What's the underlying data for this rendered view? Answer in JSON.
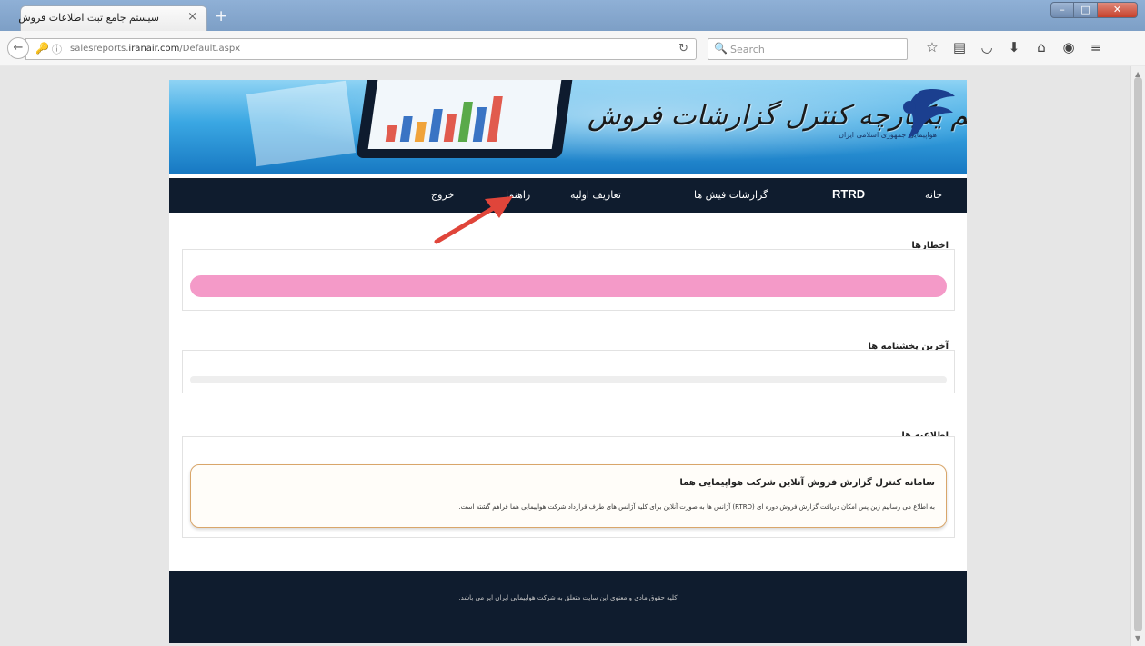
{
  "browser": {
    "tab_title": "سیستم جامع ثبت اطلاعات فروش",
    "tab_close": "×",
    "new_tab": "+",
    "url_prefix": "salesreports.",
    "url_domain": "iranair.com",
    "url_path": "/Default.aspx",
    "search_placeholder": "Search",
    "window_controls": [
      "–",
      "□",
      "✕"
    ],
    "toolbar_icons": [
      "star-icon",
      "reading-list-icon",
      "pocket-icon",
      "download-icon",
      "home-icon",
      "sync-icon",
      "menu-icon"
    ]
  },
  "page": {
    "banner_title": "سیستم یکپارچه کنترل گزارشات فروش",
    "logo_text": "هواپیمایی جمهوری اسلامی ایران",
    "menu": {
      "home": "خانه",
      "rtrd": "RTRD",
      "reports": "گزارشات فیش ها",
      "definitions": "تعاریف اولیه",
      "help": "راهنما",
      "logout": "خروج"
    },
    "alerts": {
      "title": "اخطارها"
    },
    "messages": {
      "title": "آخرین پخشنامه ها"
    },
    "announcements": {
      "title": "اطلاعیه ها",
      "notice_title": "سامانه کنترل گزارش فروش آنلاین شرکت هواپیمایی هما",
      "notice_body": "به اطلاع می رسانیم زین پس امکان دریافت گزارش فروش دوره ای (RTRD) آژانس ها به صورت آنلاین برای کلیه آژانس های طرف قرارداد شرکت هواپیمایی هما فراهم گشته است."
    },
    "footer_text": "کلیه حقوق مادی و معنوی این سایت متعلق به شرکت هواپیمایی ایران ایر می باشد."
  },
  "colors": {
    "menu_bg": "#0f1c2e",
    "alert_bar": "#f49ac8",
    "arrow": "#e0453a"
  }
}
